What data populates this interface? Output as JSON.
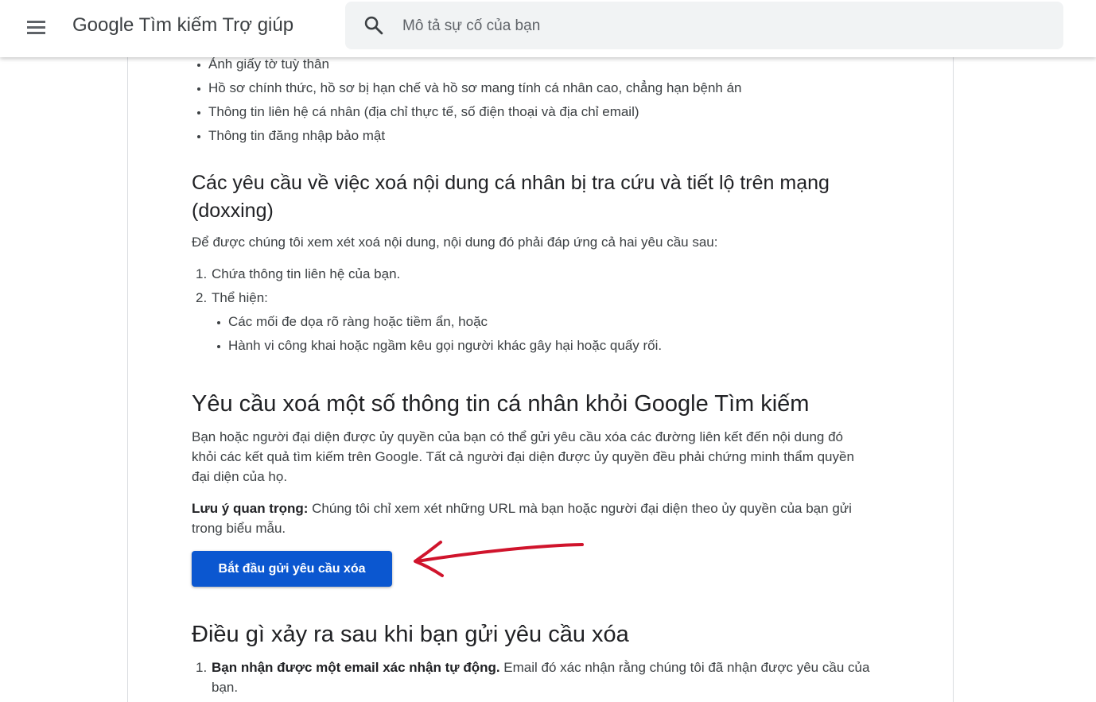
{
  "header": {
    "title": "Google Tìm kiếm Trợ giúp",
    "search_placeholder": "Mô tả sự cố của bạn"
  },
  "top_bullets": [
    "Ảnh giấy tờ tuỳ thân",
    "Hồ sơ chính thức, hồ sơ bị hạn chế và hồ sơ mang tính cá nhân cao, chẳng hạn bệnh án",
    "Thông tin liên hệ cá nhân (địa chỉ thực tế, số điện thoại và địa chỉ email)",
    "Thông tin đăng nhập bảo mật"
  ],
  "doxxing": {
    "heading_line1": "Các yêu cầu về việc xoá nội dung cá nhân bị tra cứu và tiết lộ trên mạng",
    "heading_line2": "(doxxing)",
    "intro": "Để được chúng tôi xem xét xoá nội dung, nội dung đó phải đáp ứng cả hai yêu cầu sau:",
    "items": [
      {
        "num": "1.",
        "text": "Chứa thông tin liên hệ của bạn."
      },
      {
        "num": "2.",
        "text": "Thể hiện:"
      }
    ],
    "sub_items": [
      "Các mối đe dọa rõ ràng hoặc tiềm ẩn, hoặc",
      "Hành vi công khai hoặc ngầm kêu gọi người khác gây hại hoặc quấy rối."
    ]
  },
  "request_section": {
    "heading": "Yêu cầu xoá một số thông tin cá nhân khỏi Google Tìm kiếm",
    "para_lines": [
      "Bạn hoặc người đại diện được ủy quyền của bạn có thể gửi yêu cầu xóa các đường liên kết đến nội dung đó",
      "khỏi các kết quả tìm kiếm trên Google. Tất cả người đại diện được ủy quyền đều phải chứng minh thẩm quyền",
      "đại diện của họ."
    ],
    "note_label": "Lưu ý quan trọng:",
    "note_line1": " Chúng tôi chỉ xem xét những URL mà bạn hoặc người đại diện theo ủy quyền của bạn gửi",
    "note_line2": "trong biểu mẫu.",
    "button_label": "Bắt đầu gửi yêu cầu xóa"
  },
  "after_section": {
    "heading": "Điều gì xảy ra sau khi bạn gửi yêu cầu xóa",
    "item_num": "1.",
    "item_bold": "Bạn nhận được một email xác nhận tự động.",
    "item_rest": " Email đó xác nhận rằng chúng tôi đã nhận được yêu cầu của",
    "item_line2": "bạn."
  },
  "colors": {
    "primary_button": "#0b57d0",
    "annotation_arrow": "#d0142c"
  }
}
